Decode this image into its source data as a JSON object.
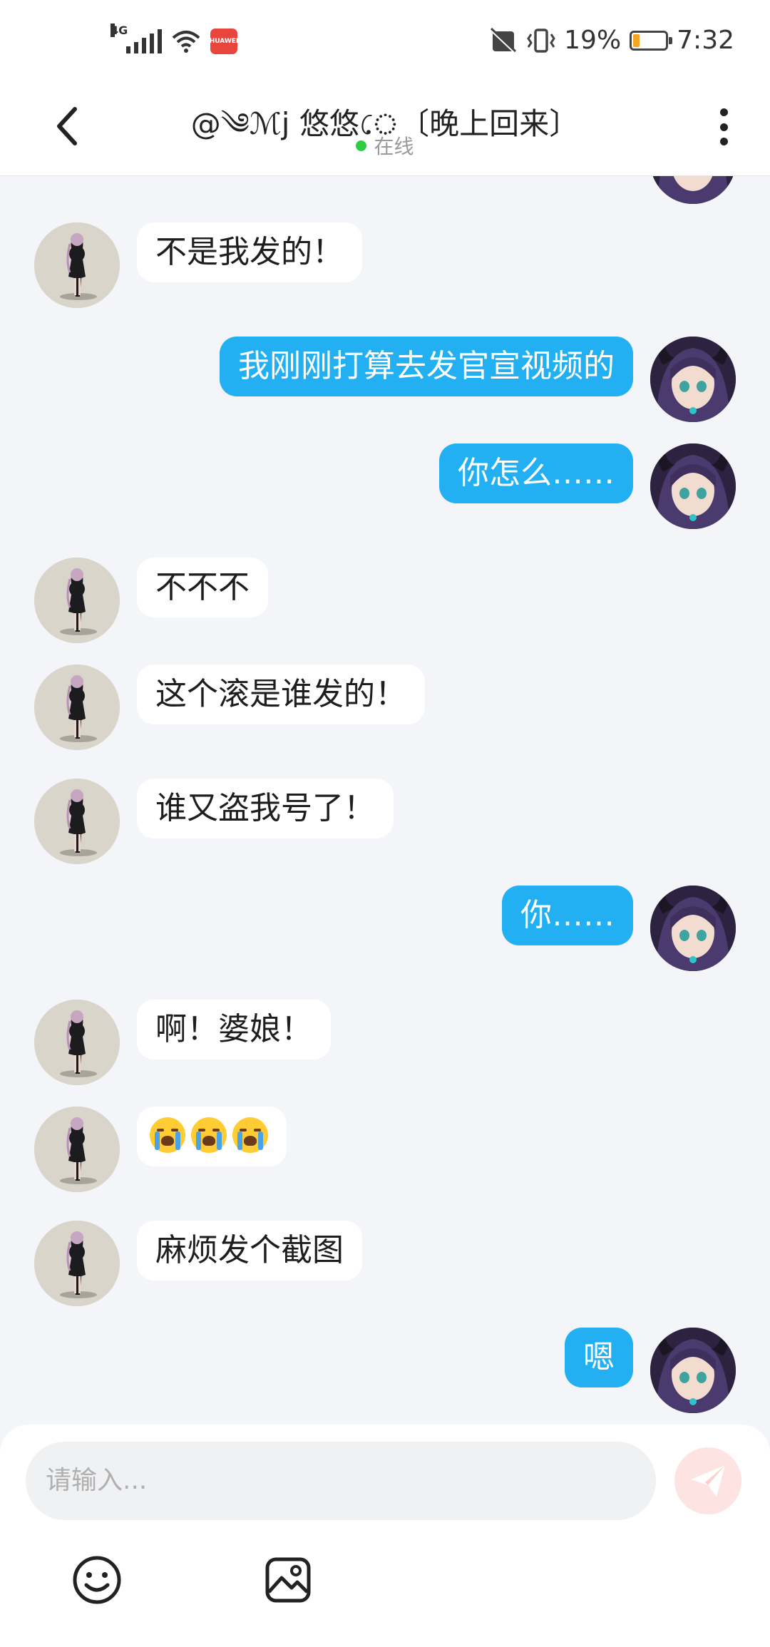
{
  "status_bar": {
    "network": "4G",
    "battery_percent": "19%",
    "battery_level": 0.19,
    "time": "7:32",
    "app_badge": "HUAWEI"
  },
  "header": {
    "title": "@༄ℳj 悠悠ে〔晚上回来〕",
    "status": "在线"
  },
  "messages": [
    {
      "side": "left",
      "text": "不是我发的！"
    },
    {
      "side": "right",
      "text": "我刚刚打算去发官宣视频的"
    },
    {
      "side": "right",
      "text": "你怎么……"
    },
    {
      "side": "left",
      "text": "不不不"
    },
    {
      "side": "left",
      "text": "这个滚是谁发的！"
    },
    {
      "side": "left",
      "text": "谁又盗我号了！"
    },
    {
      "side": "right",
      "text": "你……"
    },
    {
      "side": "left",
      "text": "啊！婆娘！"
    },
    {
      "side": "left",
      "emoji": "loudly-crying-face",
      "count": 3
    },
    {
      "side": "left",
      "text": "麻烦发个截图"
    },
    {
      "side": "right",
      "text": "嗯"
    }
  ],
  "input": {
    "placeholder": "请输入..."
  },
  "colors": {
    "sent_bubble": "#22b0f2",
    "received_bubble": "#ffffff",
    "background": "#f3f5f8",
    "online_dot": "#2ecc40",
    "send_button": "#fde4e3"
  }
}
